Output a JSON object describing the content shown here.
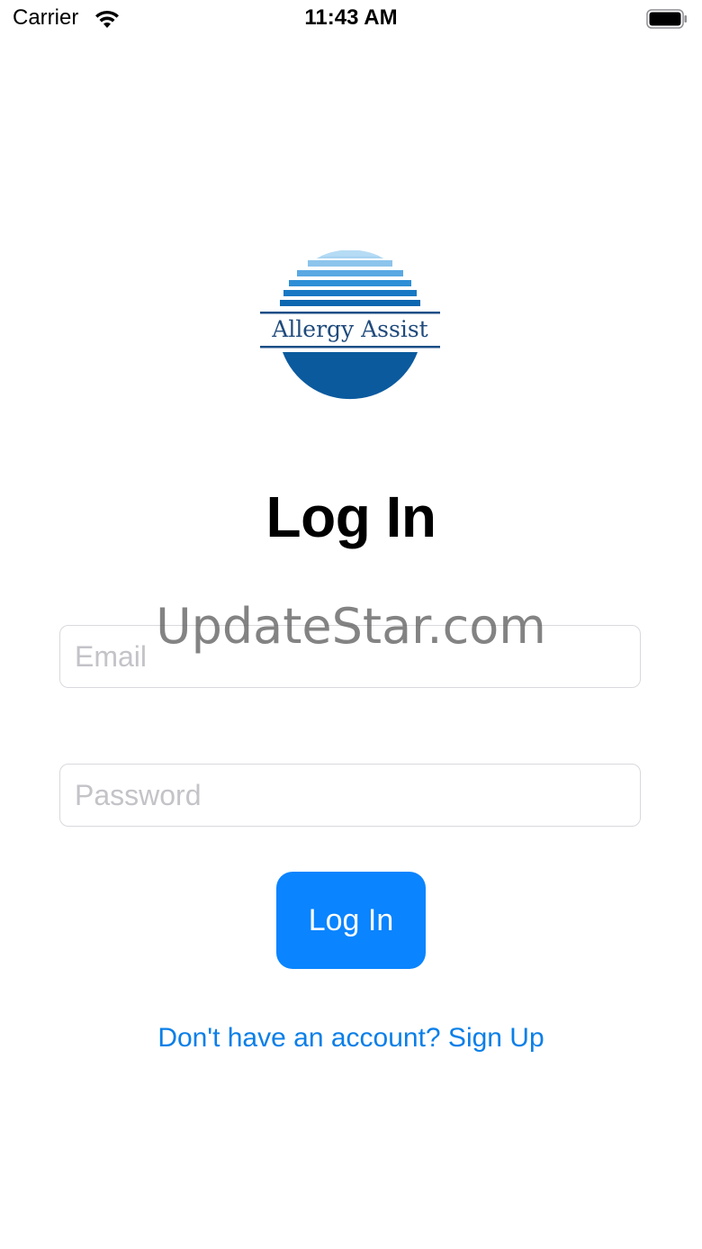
{
  "status_bar": {
    "carrier": "Carrier",
    "time": "11:43 AM",
    "wifi_icon": "wifi-icon",
    "battery_icon": "battery-icon"
  },
  "logo": {
    "text": "Allergy Assist",
    "colors": {
      "light_blue": "#8cc4ec",
      "mid_blue": "#2f8fd6",
      "dark_blue": "#0b5a9e"
    }
  },
  "title": "Log In",
  "form": {
    "email_placeholder": "Email",
    "email_value": "",
    "password_placeholder": "Password",
    "password_value": ""
  },
  "buttons": {
    "login_label": "Log In",
    "signup_link": "Don't have an account? Sign Up"
  },
  "watermark": "UpdateStar.com",
  "colors": {
    "accent": "#0a84ff",
    "link": "#0a7fe8",
    "field_border": "#d9d9de",
    "placeholder": "#c3c3c8"
  }
}
